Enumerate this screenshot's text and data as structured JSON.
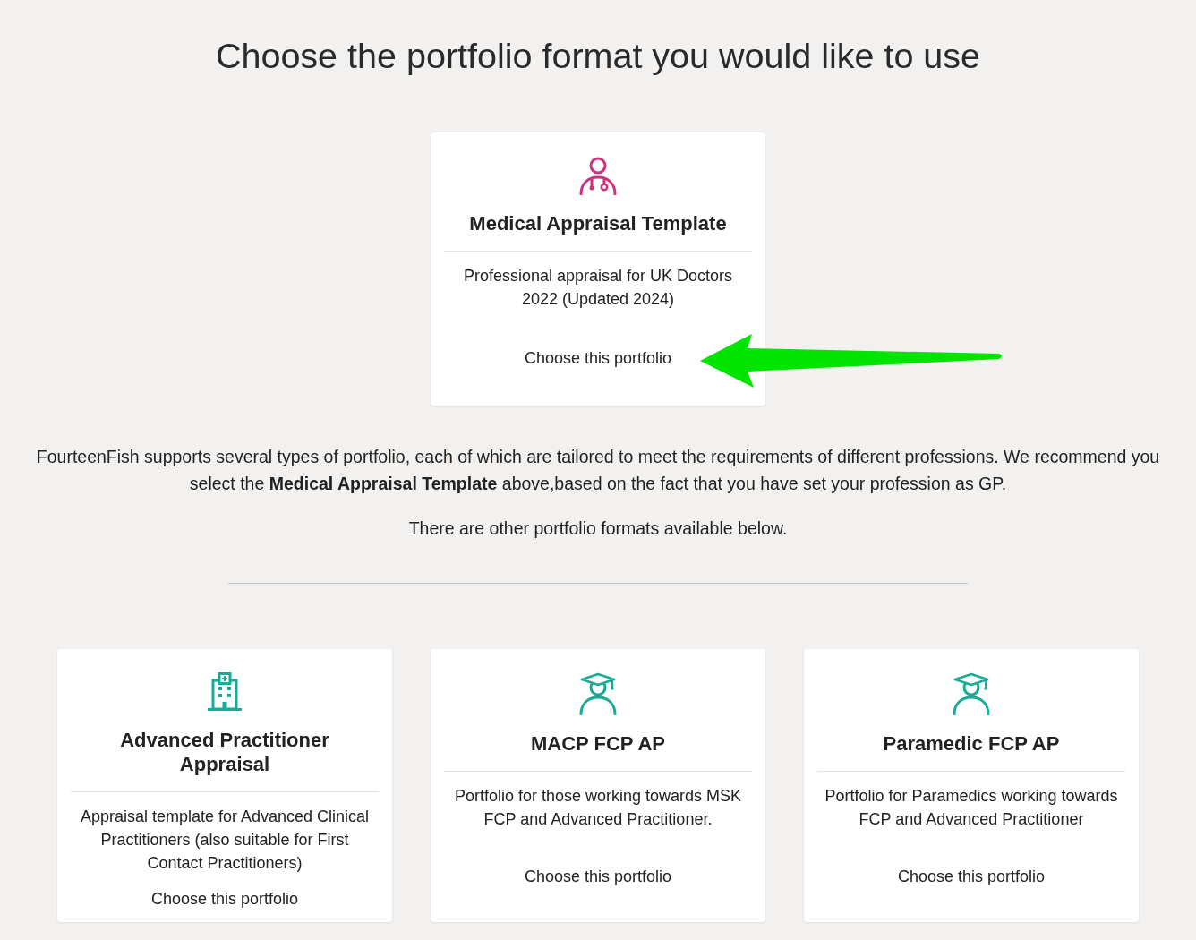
{
  "page": {
    "title": "Choose the portfolio format you would like to use"
  },
  "recommended_portfolio": {
    "kind": "doctor",
    "title": "Medical Appraisal Template",
    "description": "Professional appraisal for UK Doctors 2022 (Updated 2024)",
    "action": "Choose this portfolio"
  },
  "annotation": {
    "kind": "arrow"
  },
  "explanation": [
    "FourteenFish supports several types of portfolio, each of which are tailored to meet the requirements of different professions. We recommend you select the **Medical Appraisal Template** above,based on the fact that you have set your profession as GP.",
    "There are other portfolio formats available below."
  ],
  "other_portfolios": [
    {
      "kind": "hospital",
      "title": "Advanced Practitioner Appraisal",
      "description": "Appraisal template for Advanced Clinical Practitioners (also suitable for First Contact Practitioners)",
      "action": "Choose this portfolio"
    },
    {
      "kind": "graduate",
      "title": "MACP FCP AP",
      "description": "Portfolio for those working towards MSK FCP and Advanced Practitioner.",
      "action": "Choose this portfolio"
    },
    {
      "kind": "graduate",
      "title": "Paramedic FCP AP",
      "description": "Portfolio for Paramedics working towards FCP and Advanced Practitioner",
      "action": "Choose this portfolio"
    }
  ]
}
